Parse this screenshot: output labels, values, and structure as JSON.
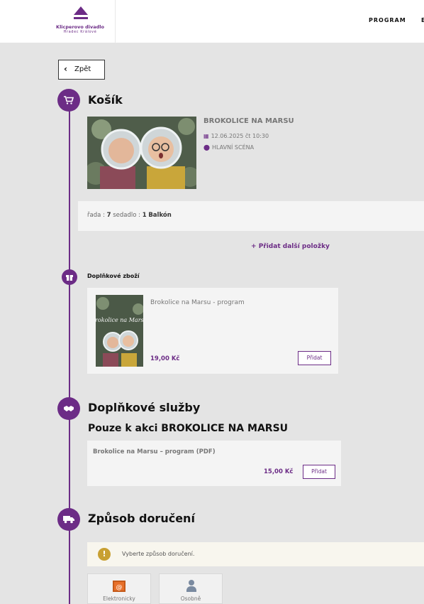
{
  "header": {
    "logo_name": "Klicperovo divadlo",
    "logo_sub": "Hradec Králové",
    "nav": [
      "PROGRAM",
      "E"
    ]
  },
  "back_label": "Zpět",
  "cart": {
    "title": "Košík",
    "event": {
      "title": "BROKOLICE NA MARSU",
      "date": "12.06.2025 čt 10:30",
      "venue": "HLAVNÍ SCÉNA"
    },
    "seat": {
      "row_label": "řada :",
      "row": "7",
      "seat_label": "sedadlo :",
      "seat": "1",
      "section": "Balkón"
    },
    "add_more": "Přidat další položky"
  },
  "merch": {
    "title": "Doplňkové zboží",
    "item": {
      "name": "Brokolice na Marsu - program",
      "price": "19,00 Kč",
      "button": "Přidat",
      "cover_text": "Brokolice na Marsu"
    }
  },
  "services": {
    "title": "Doplňkové služby",
    "subtitle": "Pouze k akci BROKOLICE NA MARSU",
    "item": {
      "name": "Brokolice na Marsu – program (PDF)",
      "price": "15,00 Kč",
      "button": "Přidat"
    }
  },
  "delivery": {
    "title": "Způsob doručení",
    "warning": "Vyberte způsob doručení.",
    "options": [
      "Elektronicky",
      "Osobně"
    ]
  },
  "colors": {
    "accent": "#6c2c86",
    "warning": "#c8a032",
    "mail": "#e8702a"
  }
}
